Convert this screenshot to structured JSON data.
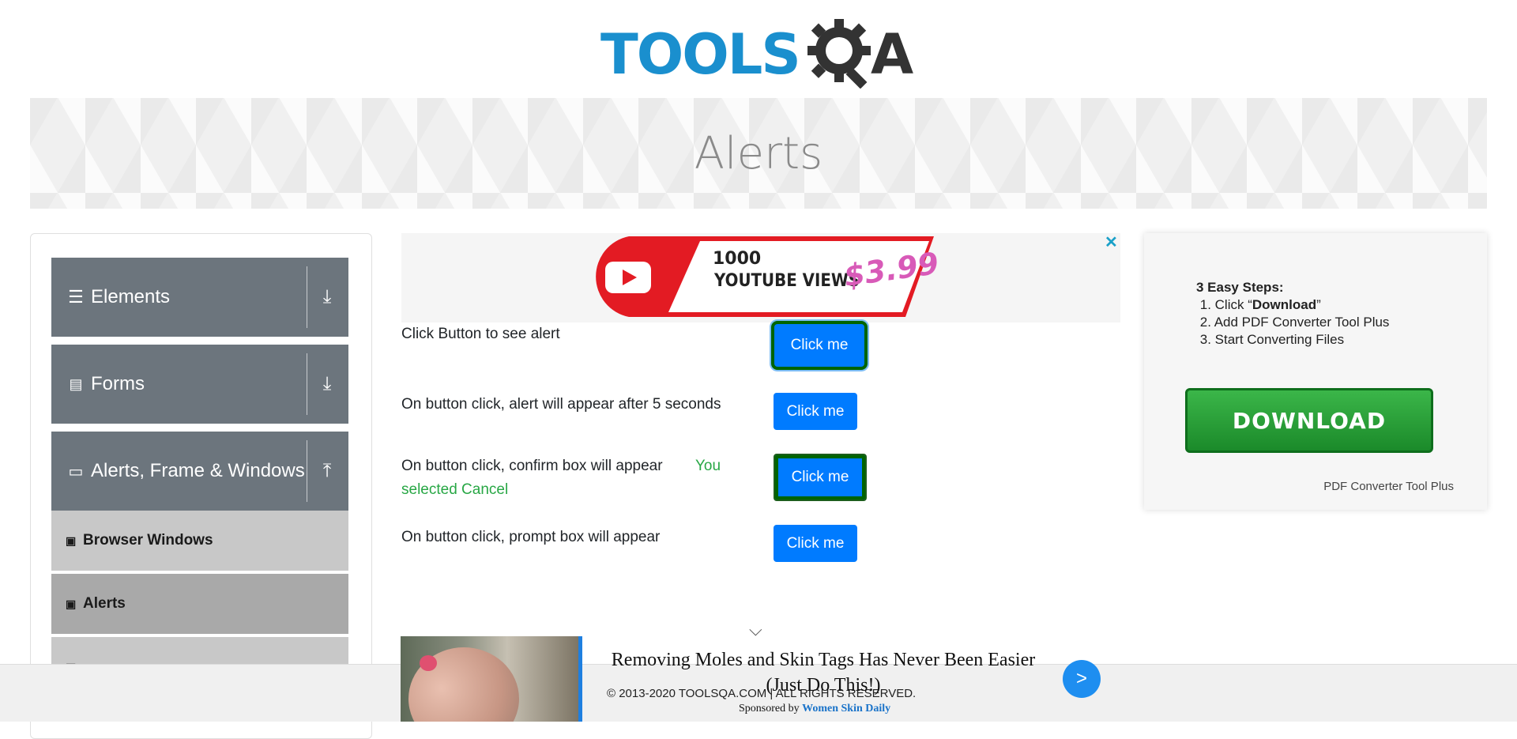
{
  "logo": {
    "text_left": "TOOLS",
    "text_right": "QA"
  },
  "banner": {
    "title": "Alerts"
  },
  "sidebar": {
    "groups": [
      {
        "label": "Elements",
        "icon": "hamburger-icon",
        "arrow": "download-arrow-icon"
      },
      {
        "label": "Forms",
        "icon": "document-icon",
        "arrow": "download-arrow-icon"
      },
      {
        "label": "Alerts, Frame & Windows",
        "icon": "window-icon",
        "arrow": "upload-arrow-icon"
      }
    ],
    "items": [
      {
        "label": "Browser Windows",
        "state": "normal"
      },
      {
        "label": "Alerts",
        "state": "active"
      },
      {
        "label": "",
        "state": "normal"
      }
    ],
    "colors": {
      "group_bg": "#6c757d",
      "item_bg": "#c8c8c8",
      "item_active_bg": "#a9a9a9"
    }
  },
  "ad_top": {
    "line1": "1000",
    "line2": "YOUTUBE VIEWS",
    "price": "$3.99",
    "close": "✕"
  },
  "alerts": [
    {
      "label": "Click Button to see alert",
      "button": "Click me",
      "result": ""
    },
    {
      "label": "On button click, alert will appear after 5 seconds",
      "button": "Click me",
      "result": ""
    },
    {
      "label": "On button click, confirm box will appear",
      "button": "Click me",
      "result_a": "You",
      "result_b": "selected Cancel"
    },
    {
      "label": "On button click, prompt box will appear",
      "button": "Click me",
      "result": ""
    }
  ],
  "ad_right": {
    "heading": "3 Easy Steps:",
    "step1_prefix": "1. Click “",
    "step1_bold": "Download",
    "step1_suffix": "”",
    "step2": "2. Add PDF Converter Tool Plus",
    "step3": "3. Start Converting Files",
    "button": "DOWNLOAD",
    "brand": "PDF Converter Tool Plus"
  },
  "native_ad": {
    "headline": "Removing Moles and Skin Tags Has Never Been Easier (Just Do This!)",
    "sponsored_prefix": "Sponsored by",
    "sponsor": "Women Skin Daily",
    "go": ">"
  },
  "footer": {
    "copyright": "© 2013-2020 TOOLSQA.COM | ALL RIGHTS RESERVED."
  },
  "colors": {
    "accent": "#007bff",
    "success": "#28a745",
    "brand_blue": "#1a8fce"
  }
}
